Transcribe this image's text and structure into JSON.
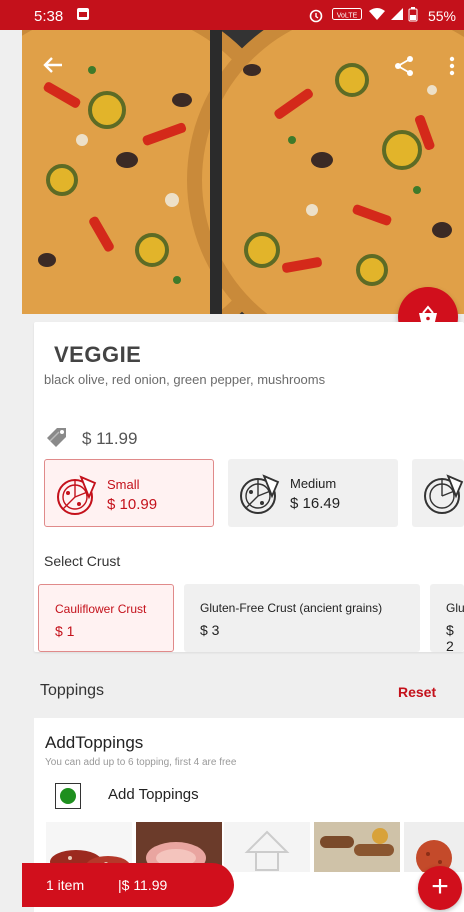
{
  "status_bar": {
    "time": "5:38",
    "battery": "55%"
  },
  "product": {
    "name": "VEGGIE",
    "description": "black olive, red onion, green pepper, mushrooms",
    "base_price": "$ 11.99"
  },
  "sizes": [
    {
      "name": "Small",
      "price": "$ 10.99",
      "selected": true
    },
    {
      "name": "Medium",
      "price": "$ 16.49",
      "selected": false
    }
  ],
  "crust": {
    "label": "Select Crust",
    "options": [
      {
        "name": "Cauliflower Crust",
        "price": "$ 1",
        "selected": true
      },
      {
        "name": "Gluten-Free Crust (ancient grains)",
        "price": "$ 3",
        "selected": false
      },
      {
        "name": "Glu",
        "price": "$ 2",
        "selected": false
      }
    ]
  },
  "toppings": {
    "header": "Toppings",
    "reset_label": "Reset",
    "add_title": "AddToppings",
    "add_subtitle": "You can add up to 6 topping, first 4 are free",
    "add_label": "Add Toppings"
  },
  "cart": {
    "items": "1 item",
    "total": "|$ 11.99"
  },
  "icons": {
    "back": "back-arrow-icon",
    "share": "share-icon",
    "more": "more-vert-icon",
    "basket": "basket-icon",
    "tag": "price-tag-icon",
    "pizza": "pizza-icon",
    "add": "plus-icon"
  },
  "colors": {
    "brand_red": "#c4111b",
    "selected_bg": "#fff2f2",
    "check_green": "#1e8f1e"
  }
}
